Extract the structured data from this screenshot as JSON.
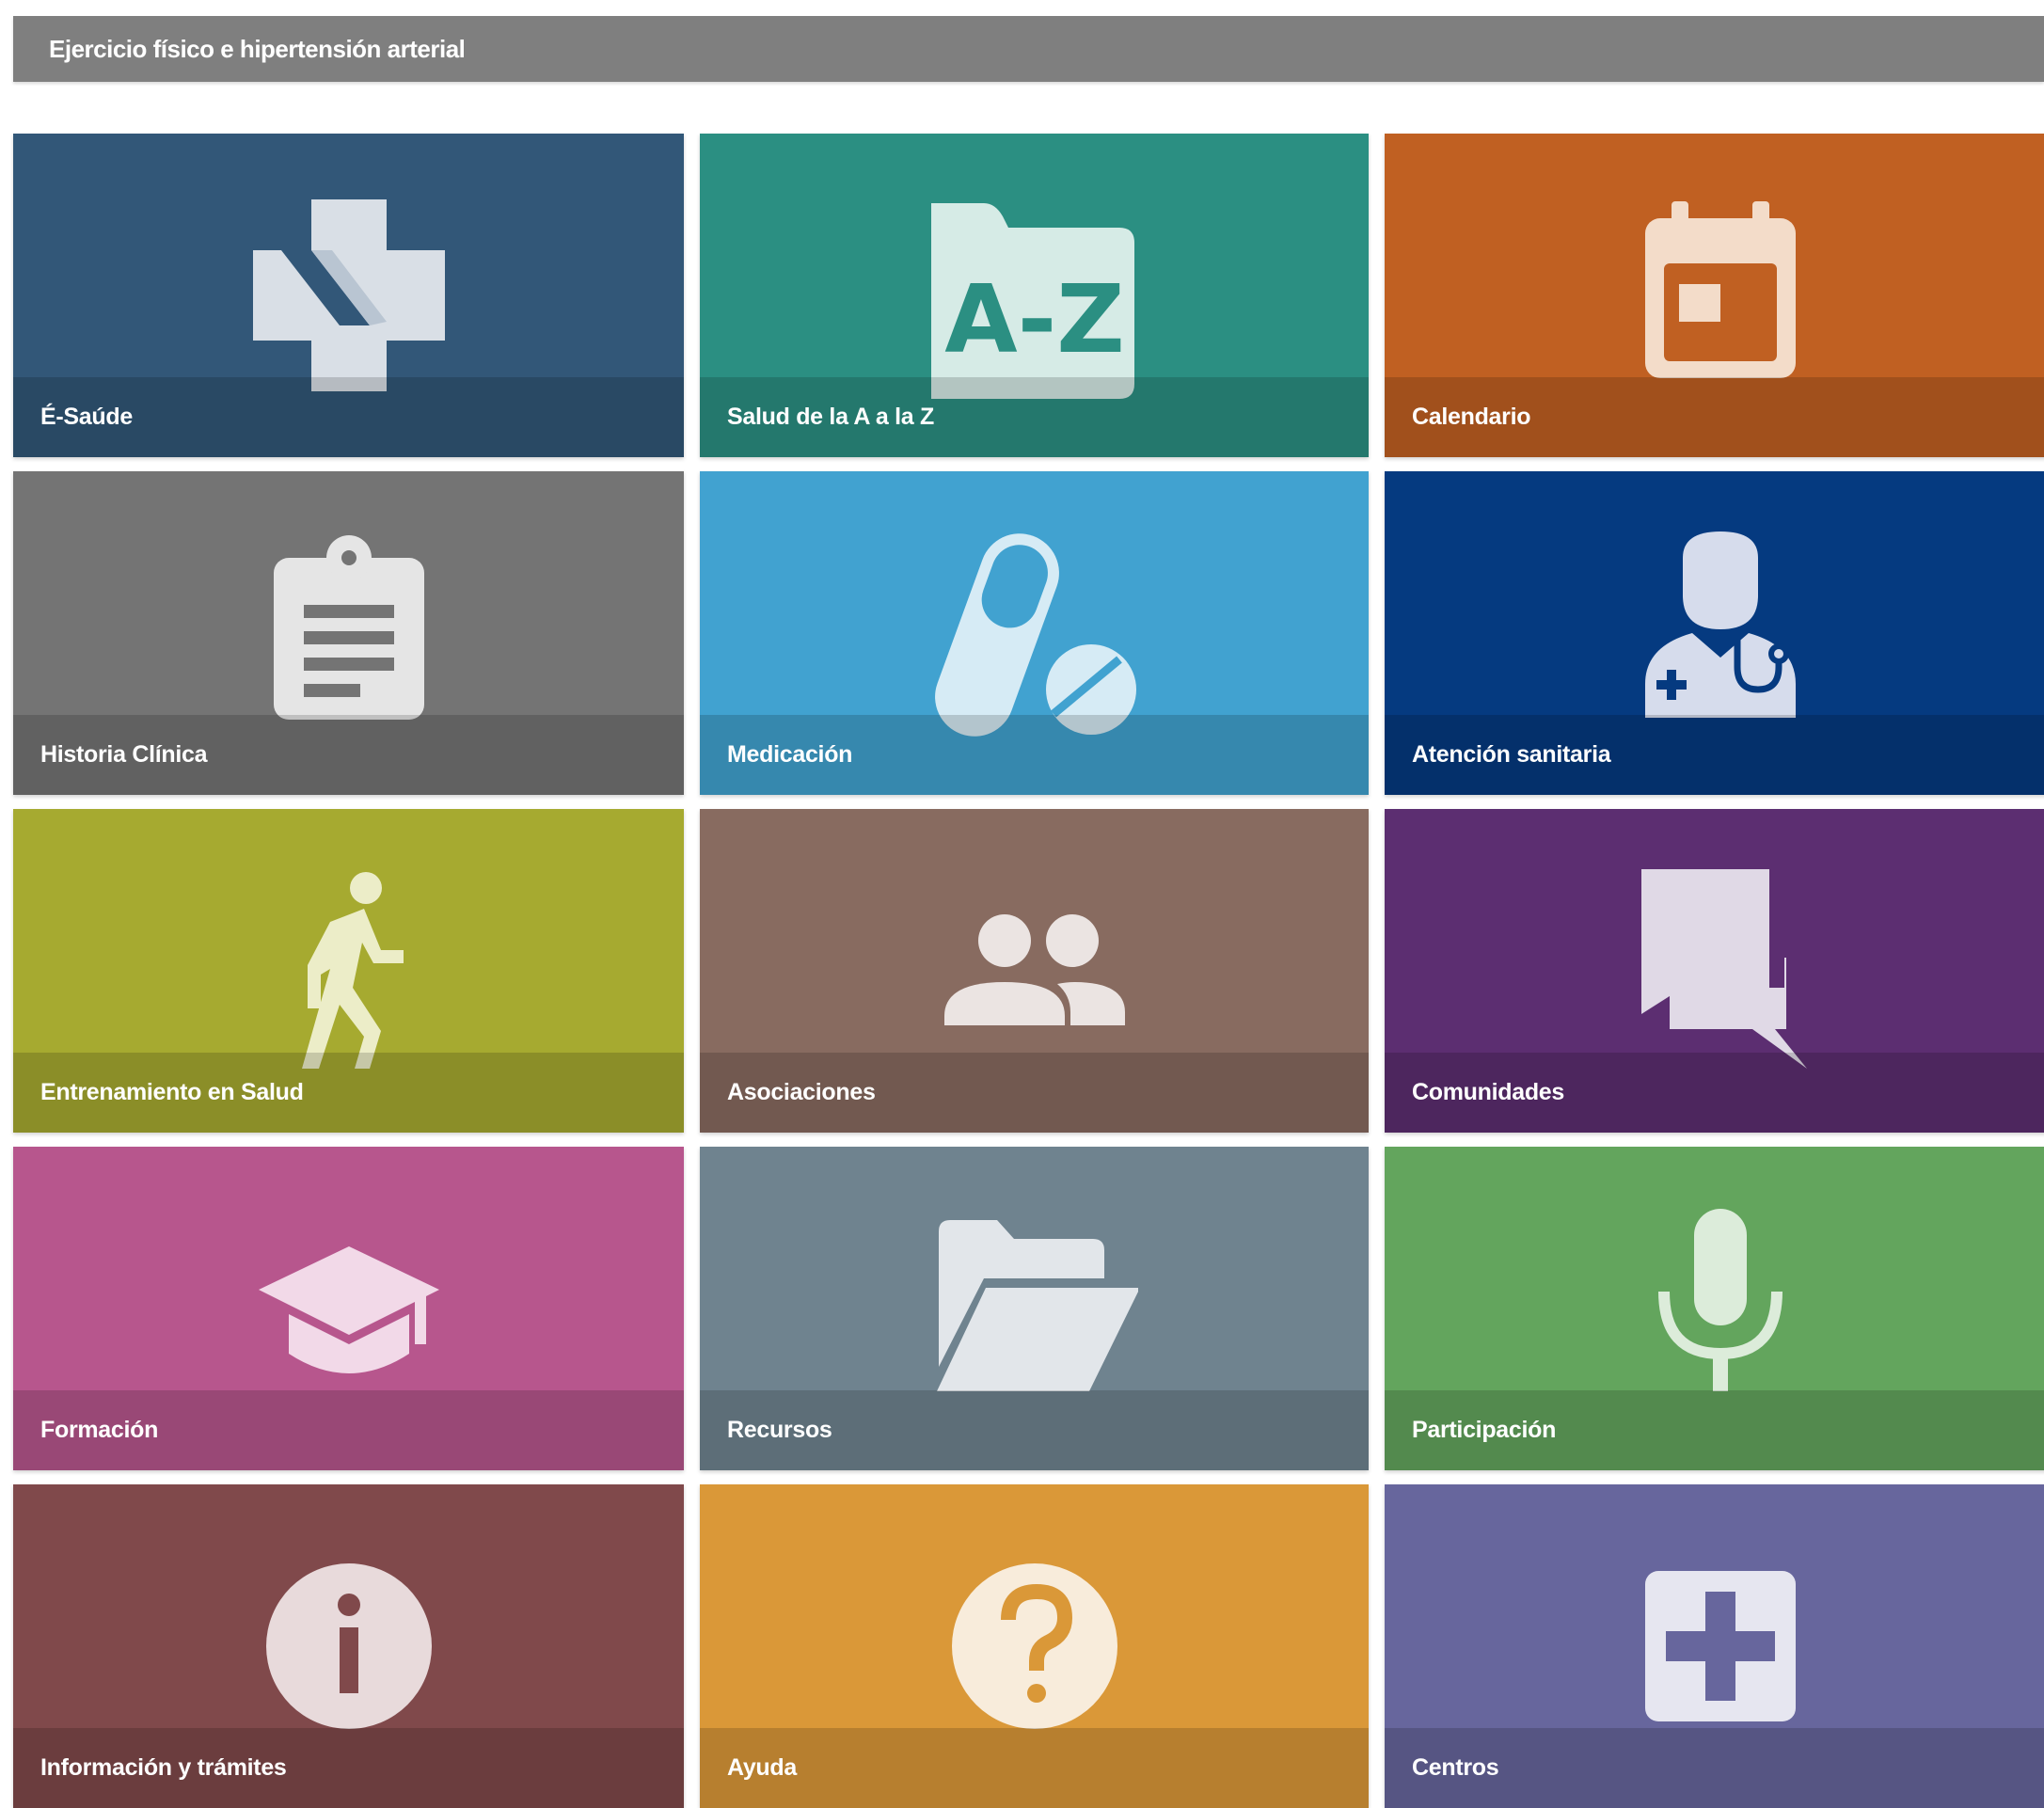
{
  "header": {
    "title": "Ejercicio físico e hipertensión arterial"
  },
  "tiles": [
    {
      "label": "É-Saúde",
      "icon": "sergas-logo-icon",
      "color": "#325778"
    },
    {
      "label": "Salud de la A a la Z",
      "icon": "a-z-folder-icon",
      "color": "#2b8f82"
    },
    {
      "label": "Calendario",
      "icon": "calendar-icon",
      "color": "#c06022"
    },
    {
      "label": "Historia Clínica",
      "icon": "clipboard-icon",
      "color": "#747474"
    },
    {
      "label": "Medicación",
      "icon": "pills-icon",
      "color": "#41a2d0"
    },
    {
      "label": "Atención sanitaria",
      "icon": "doctor-icon",
      "color": "#053a80"
    },
    {
      "label": "Entrenamiento en Salud",
      "icon": "walking-person-icon",
      "color": "#a6aa30"
    },
    {
      "label": "Asociaciones",
      "icon": "people-group-icon",
      "color": "#886b60"
    },
    {
      "label": "Comunidades",
      "icon": "chat-bubbles-icon",
      "color": "#5c2e71"
    },
    {
      "label": "Formación",
      "icon": "graduation-cap-icon",
      "color": "#b7568d"
    },
    {
      "label": "Recursos",
      "icon": "open-folder-icon",
      "color": "#6f838f"
    },
    {
      "label": "Participación",
      "icon": "microphone-icon",
      "color": "#63a55d"
    },
    {
      "label": "Información y trámites",
      "icon": "info-icon",
      "color": "#80494b"
    },
    {
      "label": "Ayuda",
      "icon": "help-question-icon",
      "color": "#da9838"
    },
    {
      "label": "Centros",
      "icon": "medical-plus-icon",
      "color": "#67669d"
    }
  ]
}
